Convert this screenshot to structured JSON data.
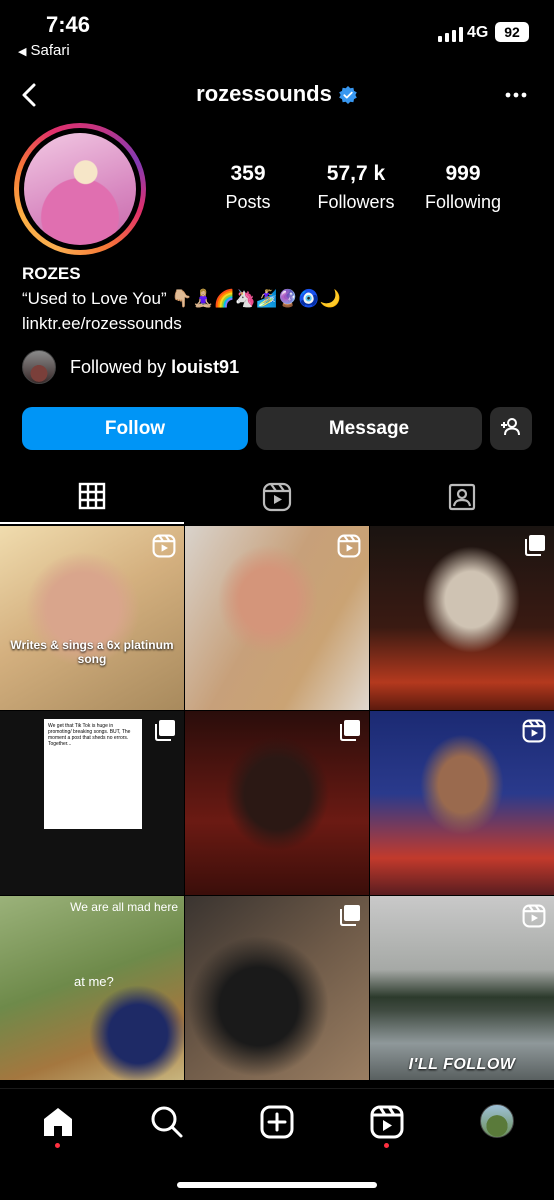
{
  "status_bar": {
    "time": "7:46",
    "back_app": "Safari",
    "network": "4G",
    "battery": "92"
  },
  "header": {
    "username": "rozessounds"
  },
  "profile": {
    "stats": [
      {
        "value": "359",
        "label": "Posts"
      },
      {
        "value": "57,7 k",
        "label": "Followers"
      },
      {
        "value": "999",
        "label": "Following"
      }
    ],
    "name": "ROZES",
    "bio": "“Used to Love You” 👇🏼🧘🏼‍♀️🌈🦄🏄🏼‍♀️🔮🧿🌙",
    "link": "linktr.ee/rozessounds",
    "followed_by_prefix": "Followed by ",
    "followed_by_user": "louist91"
  },
  "actions": {
    "follow": "Follow",
    "message": "Message"
  },
  "posts": {
    "p1_caption": "Writes & sings a 6x platinum song",
    "p4_text": "We get that Tik Tok is huge in promoting/ breaking songs. BUT, The moment a post that sheds no errors. Together...",
    "p7_top": "We are all mad here",
    "p7_mid": "at me?",
    "p9_caption": "I'LL FOLLOW"
  },
  "colors": {
    "accent": "#0095f6",
    "button_dark": "#2b2b2b",
    "notification_dot": "#ff3040"
  },
  "icons": {
    "back": "chevron-left-icon",
    "verified": "verified-badge-icon",
    "more": "more-horizontal-icon",
    "add_user": "add-user-icon",
    "grid": "grid-icon",
    "reels": "reels-icon",
    "tagged": "tagged-icon",
    "home": "home-icon",
    "search": "search-icon",
    "create": "create-icon"
  }
}
